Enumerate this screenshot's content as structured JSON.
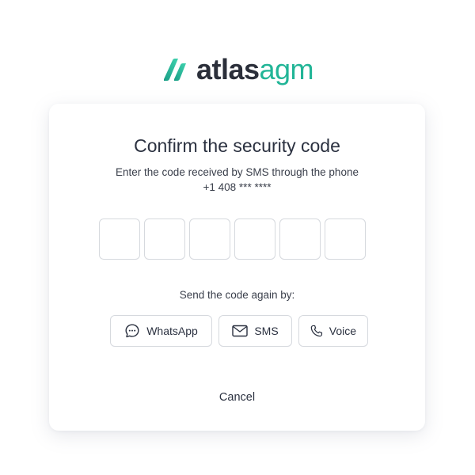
{
  "brand": {
    "name_bold": "atlas",
    "name_light": "agm",
    "logo_icon": "atlasagm-logo-icon",
    "colors": {
      "dark": "#2b2f3a",
      "accent": "#22b597"
    }
  },
  "card": {
    "title": "Confirm the security code",
    "subtitle_line1": "Enter the code received by SMS through the phone",
    "subtitle_line2": "+1 408 *** ****",
    "code_digits": [
      "",
      "",
      "",
      "",
      "",
      ""
    ],
    "resend_label": "Send the code again by:",
    "resend_options": [
      {
        "label": "WhatsApp",
        "icon": "chat-bubble-icon"
      },
      {
        "label": "SMS",
        "icon": "envelope-icon"
      },
      {
        "label": "Voice",
        "icon": "phone-icon"
      }
    ],
    "cancel_label": "Cancel"
  }
}
